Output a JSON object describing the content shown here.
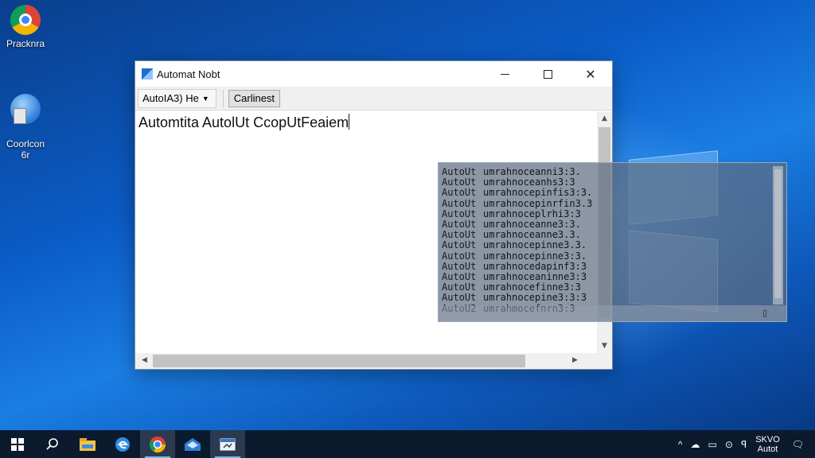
{
  "desktop": {
    "icons": [
      {
        "label": "Pracknra",
        "icon": "chrome-icon"
      },
      {
        "label": "Coorlcon\n6r",
        "icon": "computer-icon"
      }
    ]
  },
  "window": {
    "title": "Automat Nobt",
    "controls": {
      "minimize": "minimize-icon",
      "maximize": "maximize-icon",
      "close": "✕"
    },
    "toolbar": {
      "dropdown_value": "AutoIA3) He",
      "button_label": "Carlinest"
    },
    "editor_text": "Automtita AutolUt CcopUtFeaiem"
  },
  "output_panel": {
    "rows": [
      {
        "a": "AutoUt",
        "b": "umrahnoceanni3:3."
      },
      {
        "a": "AutoUt",
        "b": "umrahnoceanhs3:3"
      },
      {
        "a": "AutoUt",
        "b": "umrahnocepinfis3:3."
      },
      {
        "a": "AutoUt",
        "b": "umrahnocepinrfin3.3"
      },
      {
        "a": "AutoUt",
        "b": "umrahnoceplrhi3:3"
      },
      {
        "a": "AutoUt",
        "b": "umrahnoceanne3:3."
      },
      {
        "a": "AutoUt",
        "b": "umrahnoceanne3.3."
      },
      {
        "a": "AutoUt",
        "b": "umrahnocepinne3.3."
      },
      {
        "a": "AutoUt",
        "b": "umrahnocepinne3:3."
      },
      {
        "a": "AutoUt",
        "b": "umrahnocedapinf3:3"
      },
      {
        "a": "AutoUt",
        "b": "umrahnoceaninne3:3"
      },
      {
        "a": "AutoUt",
        "b": "umrahnocefinne3:3"
      },
      {
        "a": "AutoUt",
        "b": "umrahnocepine3:3:3"
      },
      {
        "a": "AutoU2",
        "b": "umrahmocefnrn3:3"
      }
    ]
  },
  "taskbar": {
    "items": [
      "start-icon",
      "search-icon",
      "file-explorer-icon",
      "edge-icon",
      "chrome-icon",
      "mail-icon",
      "app-icon"
    ],
    "tray": {
      "clock_top": "SKVO",
      "clock_bottom": "Autot"
    }
  }
}
